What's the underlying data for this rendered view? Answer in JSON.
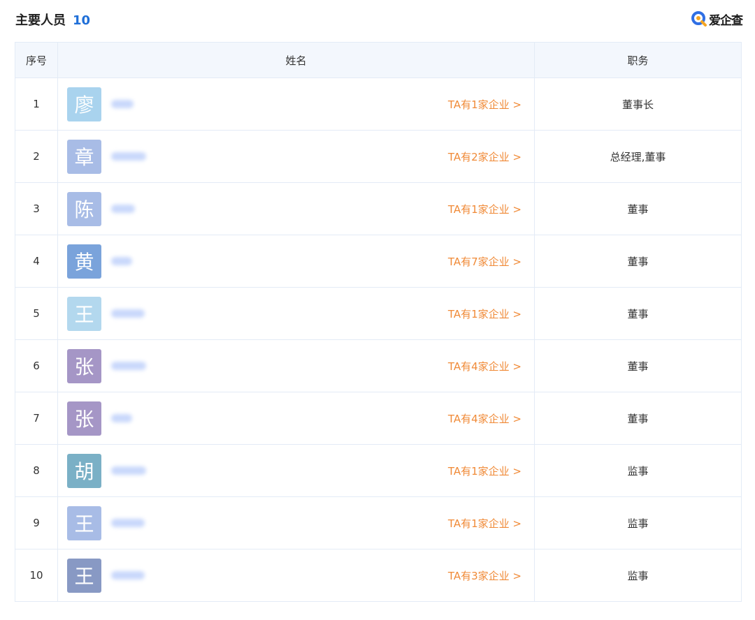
{
  "header": {
    "title": "主要人员",
    "count": "10",
    "brand": "爱企查",
    "brand_colors": {
      "ring": "#2f6fe4",
      "accent": "#f5a623"
    }
  },
  "table": {
    "columns": [
      "序号",
      "姓名",
      "职务"
    ],
    "rows": [
      {
        "index": "1",
        "surname": "廖",
        "avatar_color": "#a9d3ee",
        "blur_width": 32,
        "link": "TA有1家企业 >",
        "role": "董事长"
      },
      {
        "index": "2",
        "surname": "章",
        "avatar_color": "#a8bce6",
        "blur_width": 50,
        "link": "TA有2家企业 >",
        "role": "总经理,董事"
      },
      {
        "index": "3",
        "surname": "陈",
        "avatar_color": "#a8bce6",
        "blur_width": 34,
        "link": "TA有1家企业 >",
        "role": "董事"
      },
      {
        "index": "4",
        "surname": "黄",
        "avatar_color": "#7aa3db",
        "blur_width": 30,
        "link": "TA有7家企业 >",
        "role": "董事"
      },
      {
        "index": "5",
        "surname": "王",
        "avatar_color": "#b3d8ee",
        "blur_width": 48,
        "link": "TA有1家企业 >",
        "role": "董事"
      },
      {
        "index": "6",
        "surname": "张",
        "avatar_color": "#a596c6",
        "blur_width": 50,
        "link": "TA有4家企业 >",
        "role": "董事"
      },
      {
        "index": "7",
        "surname": "张",
        "avatar_color": "#a596c6",
        "blur_width": 30,
        "link": "TA有4家企业 >",
        "role": "董事"
      },
      {
        "index": "8",
        "surname": "胡",
        "avatar_color": "#7ab0c6",
        "blur_width": 50,
        "link": "TA有1家企业 >",
        "role": "监事"
      },
      {
        "index": "9",
        "surname": "王",
        "avatar_color": "#a8bce6",
        "blur_width": 48,
        "link": "TA有1家企业 >",
        "role": "监事"
      },
      {
        "index": "10",
        "surname": "王",
        "avatar_color": "#8899c4",
        "blur_width": 48,
        "link": "TA有3家企业 >",
        "role": "监事"
      }
    ]
  }
}
